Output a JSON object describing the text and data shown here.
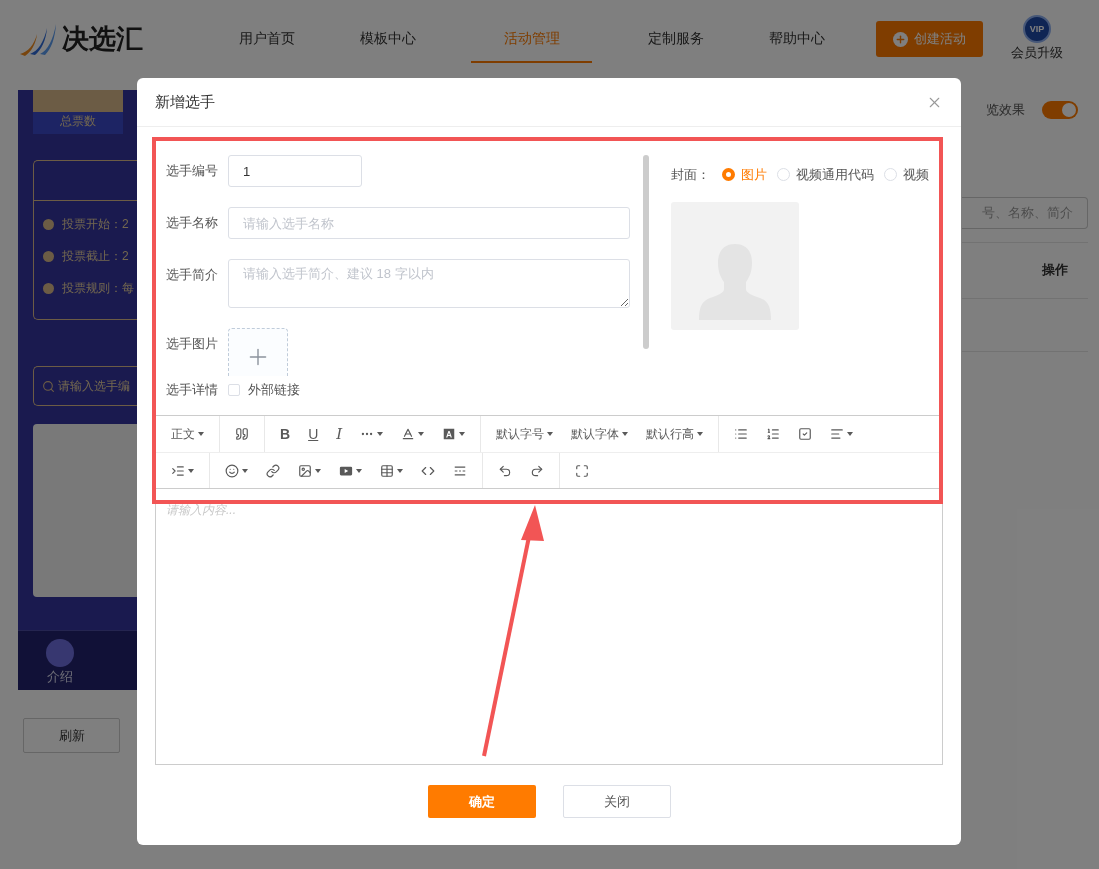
{
  "header": {
    "logo_text": "决选汇",
    "nav": [
      {
        "label": "用户首页",
        "selected": false
      },
      {
        "label": "模板中心",
        "selected": false
      },
      {
        "label": "活动管理",
        "selected": true
      },
      {
        "label": "定制服务",
        "selected": false
      },
      {
        "label": "帮助中心",
        "selected": false
      }
    ],
    "create_button": "创建活动",
    "vip_badge": "VIP",
    "vip_label": "会员升级"
  },
  "preview_panel": {
    "total_label": "总票数",
    "info_rows": [
      {
        "label": "投票开始：2"
      },
      {
        "label": "投票截止：2"
      },
      {
        "label": "投票规则：每"
      }
    ],
    "search_placeholder": "请输入选手编",
    "bottom_nav": [
      {
        "label": "介绍"
      }
    ]
  },
  "right_panel": {
    "preview_label": "览效果",
    "preview_toggle_on": true,
    "search_placeholder": "号、名称、简介",
    "table_header": "操作"
  },
  "refresh_button": "刷新",
  "dialog": {
    "title": "新增选手",
    "fields": [
      {
        "kind": "input",
        "label": "选手编号",
        "value": "1"
      },
      {
        "kind": "input",
        "label": "选手名称",
        "placeholder": "请输入选手名称"
      },
      {
        "kind": "textarea",
        "label": "选手简介",
        "placeholder": "请输入选手简介、建议 18 字以内"
      },
      {
        "kind": "upload",
        "label": "选手图片"
      },
      {
        "kind": "checkbox",
        "label": "选手详情",
        "option": "外部链接",
        "checked": false
      }
    ],
    "cover": {
      "label": "封面：",
      "options": [
        {
          "label": "图片",
          "selected": true
        },
        {
          "label": "视频通用代码",
          "selected": false
        },
        {
          "label": "视频",
          "selected": false
        }
      ]
    },
    "toolbar": {
      "rows": [
        {
          "groups": [
            [
              {
                "kind": "text",
                "label": "正文",
                "dropdown": true
              }
            ],
            [
              {
                "kind": "icon",
                "dropdown": false
              }
            ],
            [
              {
                "kind": "bold",
                "label": "B",
                "dropdown": false
              },
              {
                "kind": "underline",
                "label": "U",
                "dropdown": false
              },
              {
                "kind": "italic",
                "label": "I",
                "dropdown": false
              },
              {
                "kind": "icon",
                "dropdown": true
              },
              {
                "kind": "icon",
                "dropdown": true
              },
              {
                "kind": "icon",
                "dropdown": true
              }
            ],
            [
              {
                "kind": "text",
                "label": "默认字号",
                "dropdown": true
              },
              {
                "kind": "text",
                "label": "默认字体",
                "dropdown": true
              },
              {
                "kind": "text",
                "label": "默认行高",
                "dropdown": true
              }
            ],
            [
              {
                "kind": "icon",
                "dropdown": false
              },
              {
                "kind": "icon",
                "dropdown": false
              },
              {
                "kind": "icon",
                "dropdown": false
              },
              {
                "kind": "icon",
                "dropdown": true
              }
            ]
          ]
        },
        {
          "groups": [
            [
              {
                "kind": "icon",
                "dropdown": true
              }
            ],
            [
              {
                "kind": "icon",
                "dropdown": true
              },
              {
                "kind": "icon",
                "dropdown": false
              },
              {
                "kind": "icon",
                "dropdown": true
              },
              {
                "kind": "icon",
                "dropdown": true
              },
              {
                "kind": "icon",
                "dropdown": true
              },
              {
                "kind": "icon",
                "dropdown": false
              },
              {
                "kind": "icon",
                "dropdown": false
              }
            ],
            [
              {
                "kind": "icon",
                "dropdown": false
              },
              {
                "kind": "icon",
                "dropdown": false
              }
            ],
            [
              {
                "kind": "icon",
                "dropdown": false
              }
            ]
          ]
        }
      ]
    },
    "editor_placeholder": "请输入内容...",
    "buttons": [
      {
        "kind": "primary",
        "label": "确定"
      },
      {
        "kind": "secondary",
        "label": "关闭"
      }
    ]
  }
}
